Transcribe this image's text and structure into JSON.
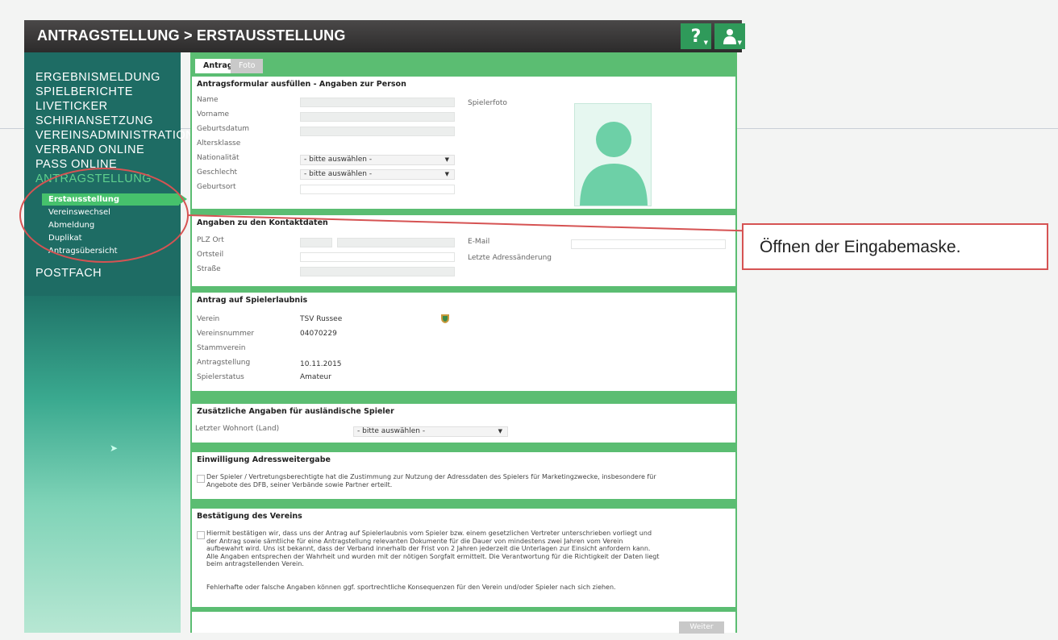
{
  "header": {
    "title": "ANTRAGSTELLUNG > ERSTAUSSTELLUNG",
    "help_label": "?",
    "user_icon": "user-icon"
  },
  "sidebar": {
    "items": [
      {
        "label": "ERGEBNISMELDUNG"
      },
      {
        "label": "SPIELBERICHTE"
      },
      {
        "label": "LIVETICKER"
      },
      {
        "label": "SCHIRIANSETZUNG"
      },
      {
        "label": "VEREINSADMINISTRATION"
      },
      {
        "label": "VERBAND ONLINE"
      },
      {
        "label": "PASS ONLINE"
      },
      {
        "label": "ANTRAGSTELLUNG"
      }
    ],
    "sub_items": [
      {
        "label": "Erstausstellung"
      },
      {
        "label": "Vereinswechsel"
      },
      {
        "label": "Abmeldung"
      },
      {
        "label": "Duplikat"
      },
      {
        "label": "Antragsübersicht"
      }
    ],
    "postfach": "POSTFACH"
  },
  "annotation": {
    "callout_text": "Öffnen der Eingabemaske."
  },
  "tabs": {
    "antrag": "Antrag",
    "foto": "Foto"
  },
  "person": {
    "title": "Antragsformular ausfüllen - Angaben zur Person",
    "name_label": "Name",
    "vorname_label": "Vorname",
    "geburtsdatum_label": "Geburtsdatum",
    "altersklasse_label": "Altersklasse",
    "nationalitaet_label": "Nationalität",
    "nationalitaet_value": "- bitte auswählen -",
    "geschlecht_label": "Geschlecht",
    "geschlecht_value": "- bitte auswählen -",
    "geburtsort_label": "Geburtsort",
    "spielerfoto_label": "Spielerfoto"
  },
  "contact": {
    "title": "Angaben zu den Kontaktdaten",
    "plz_label": "PLZ Ort",
    "ortsteil_label": "Ortsteil",
    "strasse_label": "Straße",
    "email_label": "E-Mail",
    "adress_label": "Letzte Adressänderung"
  },
  "antrag": {
    "title": "Antrag auf Spielerlaubnis",
    "verein_label": "Verein",
    "verein_value": "TSV Russee",
    "vereinsnummer_label": "Vereinsnummer",
    "vereinsnummer_value": "04070229",
    "stammverein_label": "Stammverein",
    "antragstellung_label": "Antragstellung",
    "antragstellung_value": "10.11.2015",
    "spielerstatus_label": "Spielerstatus",
    "spielerstatus_value": "Amateur"
  },
  "foreign": {
    "title": "Zusätzliche Angaben für ausländische Spieler",
    "wohnort_label": "Letzter Wohnort (Land)",
    "wohnort_value": "- bitte auswählen -"
  },
  "consent": {
    "title": "Einwilligung Adressweitergabe",
    "text_line1": "Der Spieler / Vertretungsberechtigte hat die Zustimmung zur Nutzung der Adressdaten des Spielers für Marketingzwecke, insbesondere für",
    "text_line2": "Angebote des DFB, seiner Verbände sowie Partner erteilt."
  },
  "confirm": {
    "title": "Bestätigung des Vereins",
    "line1": "Hiermit bestätigen wir, dass uns der Antrag auf Spielerlaubnis vom Spieler bzw. einem gesetzlichen Vertreter unterschrieben vorliegt und",
    "line2": "der Antrag sowie sämtliche für eine Antragstellung relevanten Dokumente für die Dauer von mindestens zwei Jahren vom Verein",
    "line3": "aufbewahrt wird. Uns ist bekannt, dass der Verband innerhalb der Frist von 2 Jahren jederzeit die Unterlagen zur Einsicht anfordern kann.",
    "line4": "Alle Angaben entsprechen der Wahrheit und wurden mit der nötigen Sorgfalt ermittelt. Die Verantwortung für die Richtigkeit der Daten liegt",
    "line5": "beim antragstellenden Verein.",
    "line6": "Fehlerhafte oder falsche Angaben können ggf. sportrechtliche Konsequenzen für den Verein und/oder Spieler nach sich ziehen."
  },
  "footer": {
    "weiter_label": "Weiter"
  }
}
